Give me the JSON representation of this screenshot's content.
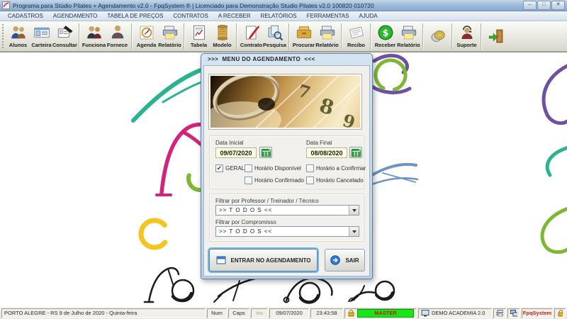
{
  "window": {
    "title": "Programa para Stúdio Pilates + Agendamento v2.0 - FpqSystem ® | Licenciado para  Demonstração Studio Pilates v2.0 100820 010720",
    "minimize": "–",
    "maximize": "□",
    "close": "✕"
  },
  "menu": {
    "items": [
      "CADASTROS",
      "AGENDAMENTO",
      "TABELA DE PREÇOS",
      "CONTRATOS",
      "A RECEBER",
      "RELATÓRIOS",
      "FERRAMENTAS",
      "AJUDA"
    ]
  },
  "toolbar": {
    "items": [
      {
        "label": "Alunos",
        "icon": "students-icon"
      },
      {
        "label": "Carteira",
        "icon": "id-card-icon"
      },
      {
        "label": "Consultar",
        "icon": "consult-card-icon"
      },
      {
        "label": "Funciona",
        "icon": "employees-icon"
      },
      {
        "label": "Fornece",
        "icon": "supplier-icon"
      },
      {
        "label": "Agenda",
        "icon": "agenda-icon"
      },
      {
        "label": "Relatório",
        "icon": "report-printer-icon"
      },
      {
        "label": "Tabela",
        "icon": "table-doc-icon"
      },
      {
        "label": "Modelo",
        "icon": "scroll-icon"
      },
      {
        "label": "Contrato",
        "icon": "contract-quill-icon"
      },
      {
        "label": "Pesquisa",
        "icon": "search-docs-icon"
      },
      {
        "label": "Procurar",
        "icon": "file-drawer-icon"
      },
      {
        "label": "Relatório",
        "icon": "report-printer-icon"
      },
      {
        "label": "Recibo",
        "icon": "receipt-icon"
      },
      {
        "label": "Receber",
        "icon": "dollar-coin-icon"
      },
      {
        "label": "Relatório",
        "icon": "report-printer-icon"
      },
      {
        "label": "",
        "icon": "coins-icon"
      },
      {
        "label": "Suporte",
        "icon": "support-person-icon"
      },
      {
        "label": "",
        "icon": "exit-door-icon"
      }
    ]
  },
  "dialog": {
    "title": ">>>  MENU DO AGENDAMENTO  <<<",
    "calendar_numbers": [
      "7",
      "8",
      "9"
    ],
    "date_start_label": "Data Inicial",
    "date_start_value": "09/07/2020",
    "date_end_label": "Data Final",
    "date_end_value": "08/08/2020",
    "check_glyph": "✔",
    "chk_geral": "GERAL",
    "chk_disponivel": "Horário  Disponível",
    "chk_confirmar": "Horário a Confirmar",
    "chk_confirmado": "Horário Confirmado",
    "chk_cancelado": "Horário Cancelado",
    "filter1_label": "Filtrar por Professor / Treinador / Técnico",
    "filter1_value": ">> T O D O S <<",
    "filter2_label": "Filtrar por Compromisso",
    "filter2_value": ">> T O D O S <<",
    "enter_button": "ENTRAR NO AGENDAMENTO",
    "exit_button": "SAIR"
  },
  "statusbar": {
    "location": "PORTO ALEGRE - RS  9 de Julho de 2020 - Quinta-feira",
    "num": "Num",
    "caps": "Caps",
    "ins": "Ins",
    "date": "09/07/2020",
    "time": "23:43:58",
    "user": "MASTER",
    "system": "DEMO ACADEMIA 2.0",
    "brand": "FpqSystem"
  },
  "colors": {
    "master_bg": "#17e617",
    "master_text": "#cc1111",
    "brand_text": "#cc2222",
    "date_field_bg": "#ffffe1"
  }
}
